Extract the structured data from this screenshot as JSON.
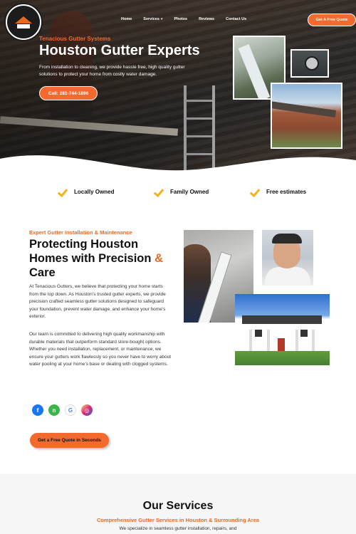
{
  "brand": {
    "logo_text": "TENACIOUS",
    "logo_sub": "GUTTER SYSTEMS",
    "logo_est": "EST 2024"
  },
  "nav": {
    "items": [
      "Home",
      "Services",
      "Photos",
      "Reviews",
      "Contact Us"
    ],
    "cta_label": "Get A Free Quote"
  },
  "hero": {
    "kicker": "Tenacious Gutter Systems",
    "title": "Houston Gutter Experts",
    "description": "From installation to cleaning, we provide hassle free, high quality gutter solutions to protect your home from costly water damage.",
    "call_label": "Call: 281-744-1896"
  },
  "features": [
    "Locally Owned",
    "Family Owned",
    "Free estimates"
  ],
  "about": {
    "kicker": "Expert Gutter Installation & Maintenance",
    "title_main": "Protecting Houston Homes with Precision",
    "title_amp": "&",
    "title_end": "Care",
    "paragraph1": "At Tenacious Gutters, we believe that protecting your home starts from the top down. As Houston’s trusted gutter experts, we provide precision crafted seamless gutter solutions designed to safeguard your foundation, prevent water damage, and enhance your home’s exterior.",
    "paragraph2": "Our team is committed to delivering high quality workmanship with durable materials that outperform standard store-bought options. Whether you need installation, replacement, or maintenance, we ensure your gutters work flawlessly so you never have to worry about water pooling at your home’s base or dealing with clogged systems.",
    "quote_label": "Get a Free Quote in Seconds"
  },
  "social": [
    {
      "name": "facebook-icon",
      "glyph": "f"
    },
    {
      "name": "nextdoor-icon",
      "glyph": "n"
    },
    {
      "name": "google-icon",
      "glyph": "G"
    },
    {
      "name": "instagram-icon",
      "glyph": "◎"
    }
  ],
  "services": {
    "title": "Our Services",
    "subtitle": "Comprehensive Gutter Services in Houston & Surrounding Area",
    "description": "We specialize in seamless gutter installation, repairs, and"
  },
  "colors": {
    "accent": "#f26a2e",
    "check": "#f2b21c"
  }
}
